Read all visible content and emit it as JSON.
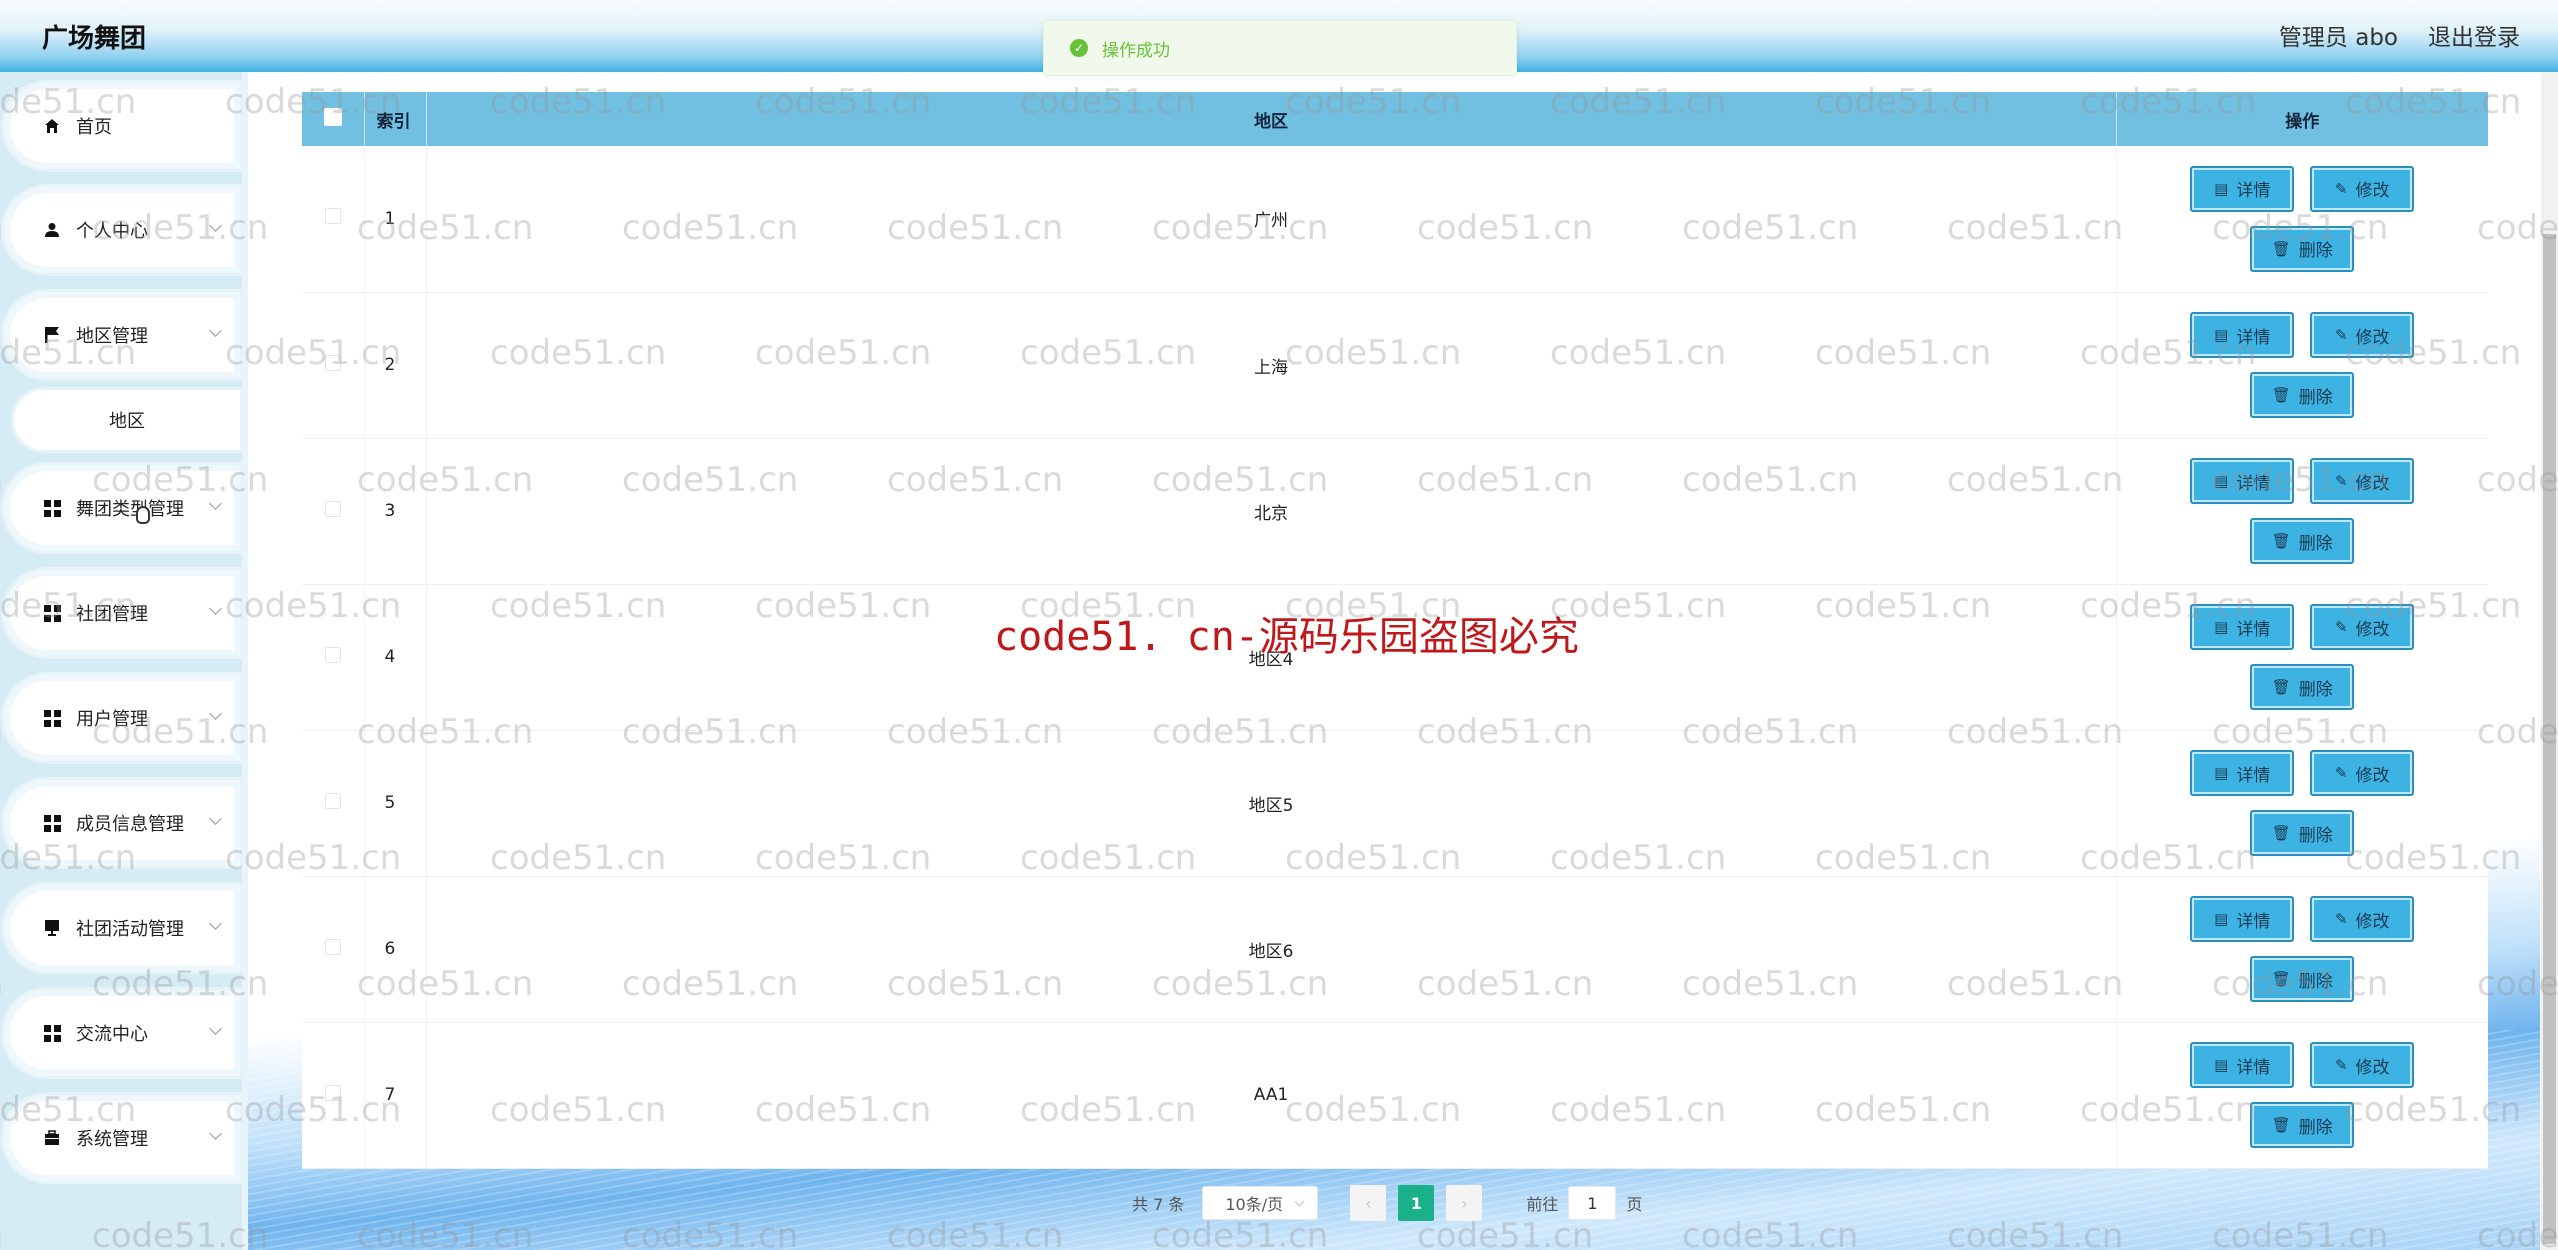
{
  "app": {
    "title": "广场舞团",
    "user_label": "管理员 abo",
    "logout_label": "退出登录"
  },
  "toast": {
    "icon": "check-circle-icon",
    "message": "操作成功",
    "color": "#67c23a"
  },
  "sidebar": {
    "items": [
      {
        "label": "首页",
        "icon": "home-icon",
        "has_arrow": false
      },
      {
        "label": "个人中心",
        "icon": "user-icon",
        "has_arrow": true
      },
      {
        "label": "地区管理",
        "icon": "flag-icon",
        "has_arrow": true,
        "expanded": true,
        "children": [
          {
            "label": "地区"
          }
        ]
      },
      {
        "label": "舞团类型管理",
        "icon": "grid-icon",
        "has_arrow": true
      },
      {
        "label": "社团管理",
        "icon": "grid-icon",
        "has_arrow": true
      },
      {
        "label": "用户管理",
        "icon": "grid-icon",
        "has_arrow": true
      },
      {
        "label": "成员信息管理",
        "icon": "grid-icon",
        "has_arrow": true
      },
      {
        "label": "社团活动管理",
        "icon": "monitor-icon",
        "has_arrow": true
      },
      {
        "label": "交流中心",
        "icon": "grid-icon",
        "has_arrow": true
      },
      {
        "label": "系统管理",
        "icon": "briefcase-icon",
        "has_arrow": true
      }
    ]
  },
  "table": {
    "columns": {
      "select": "",
      "index": "索引",
      "region": "地区",
      "actions": "操作"
    },
    "header_color": "#72c0e1",
    "rows": [
      {
        "index": "1",
        "region": "广州"
      },
      {
        "index": "2",
        "region": "上海"
      },
      {
        "index": "3",
        "region": "北京"
      },
      {
        "index": "4",
        "region": "地区4"
      },
      {
        "index": "5",
        "region": "地区5"
      },
      {
        "index": "6",
        "region": "地区6"
      },
      {
        "index": "7",
        "region": "AA1"
      }
    ],
    "actions": {
      "detail": "详情",
      "edit": "修改",
      "delete": "删除"
    },
    "button_color": "#3cb3e3"
  },
  "pagination": {
    "total_text": "共 7 条",
    "page_size": "10条/页",
    "prev": "‹",
    "next": "›",
    "current_page": "1",
    "goto_label": "前往",
    "goto_value": "1",
    "page_suffix": "页",
    "active_color": "#19b08a"
  },
  "watermark": {
    "text": "code51.cn",
    "center_text": "code51. cn-源码乐园盗图必究"
  }
}
